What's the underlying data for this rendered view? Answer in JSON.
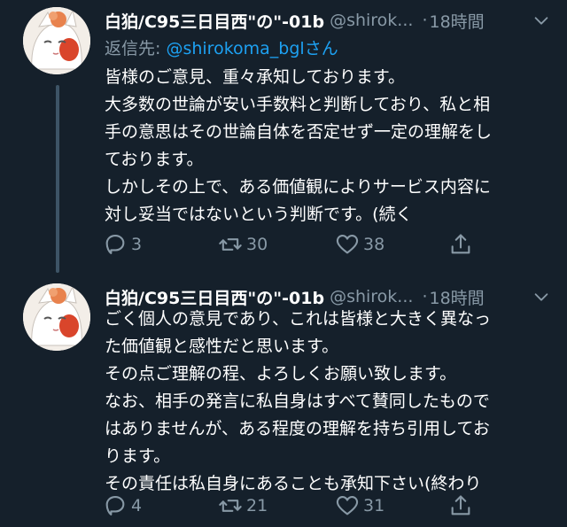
{
  "tweets": [
    {
      "display_name": "白狛/C95三日目西\"の\"-01b",
      "handle": "@shirok...",
      "separator": "·",
      "time": "18時間",
      "reply_prefix": "返信先: ",
      "reply_to": "@shirokoma_bglさん",
      "lines": [
        "皆様のご意見、重々承知しております。",
        "大多数の世論が安い手数料と判断しており、私と相",
        "手の意思はその世論自体を否定せず一定の理解をし",
        "ております。",
        "しかしその上で、ある価値観によりサービス内容に",
        "対し妥当ではないという判断です。(続く"
      ],
      "replies": "3",
      "retweets": "30",
      "likes": "38"
    },
    {
      "display_name": "白狛/C95三日目西\"の\"-01b",
      "handle": "@shirok...",
      "separator": "·",
      "time": "18時間",
      "lines": [
        "ごく個人の意見であり、これは皆様と大きく異なっ",
        "た価値観と感性だと思います。",
        "その点ご理解の程、よろしくお願い致します。",
        "なお、相手の発言に私自身はすべて賛同したもので",
        "はありませんが、ある程度の理解を持ち引用してお",
        "ります。",
        "その責任は私自身にあることも承知下さい(終わり"
      ],
      "replies": "4",
      "retweets": "21",
      "likes": "31"
    }
  ],
  "colors": {
    "background": "#15202b",
    "text": "#ffffff",
    "secondary": "#8899a6",
    "link": "#1da1f2",
    "thread_line": "#3d5466"
  },
  "icons": {
    "reply": "reply-icon",
    "retweet": "retweet-icon",
    "like": "heart-icon",
    "share": "share-icon",
    "menu": "chevron-down-icon"
  }
}
